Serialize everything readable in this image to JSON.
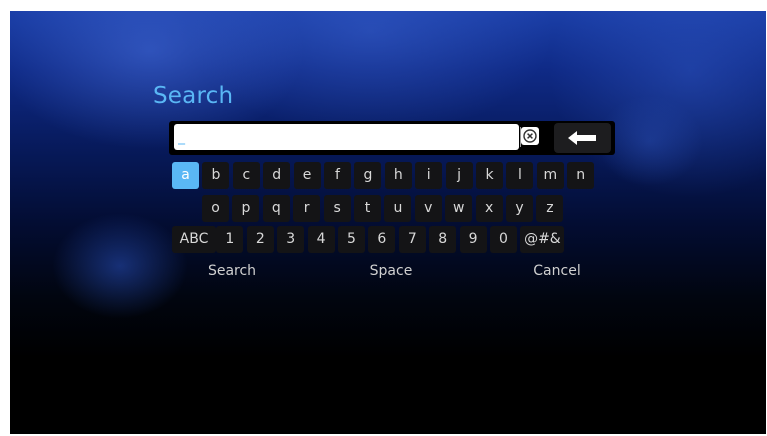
{
  "search": {
    "title": "Search",
    "input_value": "_",
    "clear_icon": "clear-x-icon",
    "backspace_icon": "backspace-arrow-icon"
  },
  "keyboard": {
    "row1": [
      "a",
      "b",
      "c",
      "d",
      "e",
      "f",
      "g",
      "h",
      "i",
      "j",
      "k",
      "l",
      "m",
      "n"
    ],
    "row2": [
      "o",
      "p",
      "q",
      "r",
      "s",
      "t",
      "u",
      "v",
      "w",
      "x",
      "y",
      "z"
    ],
    "row3": [
      "ABC",
      "1",
      "2",
      "3",
      "4",
      "5",
      "6",
      "7",
      "8",
      "9",
      "0",
      "@#&"
    ],
    "selected_key": "a"
  },
  "actions": {
    "search_label": "Search",
    "space_label": "Space",
    "cancel_label": "Cancel"
  },
  "colors": {
    "accent": "#5ab7f5",
    "key_background": "#141416",
    "key_text": "#d8d8d8"
  }
}
